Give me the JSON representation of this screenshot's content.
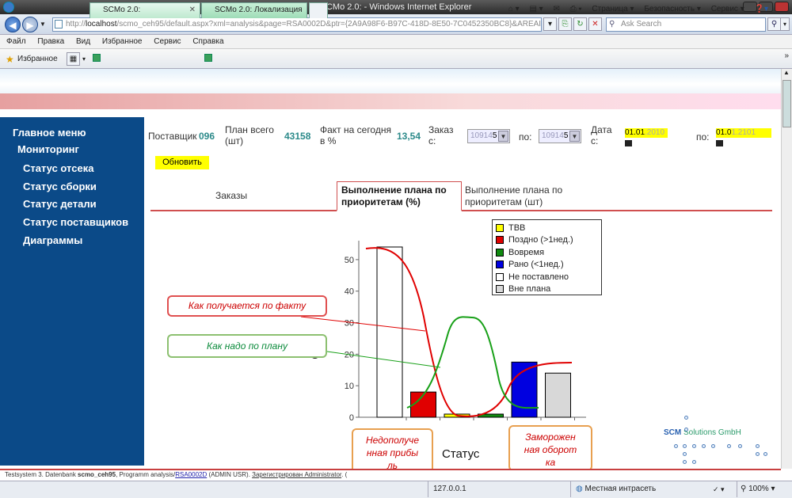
{
  "window": {
    "title": "SCMo 2.0: - Windows Internet Explorer"
  },
  "address": {
    "url_prefix": "http://",
    "url_host": "localhost",
    "url_rest": "/scmo_ceh95/default.aspx?xml=analysis&page=RSA0002D&ptr={2A9A98F6-B97C-418D-8E50-7C0452350BC8}&AREAID=2",
    "search_placeholder": "Ask Search"
  },
  "menubar": [
    "Файл",
    "Правка",
    "Вид",
    "Избранное",
    "Сервис",
    "Справка"
  ],
  "favbar": {
    "favorites_label": "Избранное",
    "tabs": [
      "SCMo 2.0:",
      "SCMo 2.0: Локализация"
    ],
    "tab_close": "✕",
    "commands": [
      "Страница ▾",
      "Безопасность ▾",
      "Сервис ▾"
    ]
  },
  "sidebar": {
    "items": [
      "Главное меню",
      "Мониторинг",
      "Статус отсека",
      "Статус сборки",
      "Статус детали",
      "Статус поставщиков",
      "Диаграммы"
    ]
  },
  "filters": {
    "supplier_label": "Поставщик",
    "supplier_value": "096",
    "plan_label_1": "План всего",
    "plan_label_2": "(шт)",
    "plan_value": "43158",
    "fact_label_1": "Факт на сегодня",
    "fact_label_2": "в %",
    "fact_value": "13,54",
    "order_label_1": "Заказ",
    "order_label_2": "с:",
    "order_from": "10914",
    "order_from_suffix": "5",
    "to_label": "по:",
    "order_to": "10914",
    "order_to_suffix": "5",
    "date_label_1": "Дата",
    "date_label_2": "с:",
    "date_from_a": "01.01",
    "date_from_b": ".2010",
    "date_to_label": "по:",
    "date_to_a": "01.0",
    "date_to_b": "1.2101",
    "update_button": "Обновить"
  },
  "tabs": [
    "Заказы",
    "Выполнение плана по приоритетам (%)",
    "Выполнение плана по приоритетам (шт)"
  ],
  "callouts": {
    "fact": "Как получается по факту",
    "plan": "Как надо по плану",
    "lost_profit": "Недополученная прибыль",
    "frozen": "Замороженная оборотка"
  },
  "brand": {
    "scm": "SCM",
    "rest": "Solutions GmbH"
  },
  "footer": {
    "text_1": "Testsystem 3. Datenbank ",
    "db": "scmo_ceh95",
    "text_2": ", Programm analysis/",
    "prog": "RSA0002D",
    "text_3": " (ADMIN USR). ",
    "user": "Зарегистрирован Administrator",
    "text_4": ". ("
  },
  "status": {
    "ip": "127.0.0.1",
    "zone": "Местная интрасеть",
    "zoom": "100%"
  },
  "chart_data": {
    "type": "bar",
    "categories": [
      "Не поставлено",
      "Поздно (>1нед.)",
      "ТВВ",
      "Вовремя",
      "Рано (<1нед.)",
      "Вне плана"
    ],
    "values": [
      54,
      8,
      1,
      1,
      17.5,
      14
    ],
    "colors": [
      "#ffffff",
      "#e00000",
      "#ffff00",
      "#108a10",
      "#0000e0",
      "#d8d8d8"
    ],
    "xlabel": "Статус",
    "ylabel": "С",
    "ylim": [
      0,
      55
    ],
    "yticks": [
      0,
      10,
      20,
      30,
      40,
      50
    ],
    "legend": [
      {
        "label": "ТВВ",
        "color": "#ffff00"
      },
      {
        "label": "Поздно (>1нед.)",
        "color": "#e00000"
      },
      {
        "label": "Вовремя",
        "color": "#108a10"
      },
      {
        "label": "Рано (<1нед.)",
        "color": "#0000e0"
      },
      {
        "label": "Не поставлено",
        "color": "#ffffff"
      },
      {
        "label": "Вне плана",
        "color": "#d8d8d8"
      }
    ],
    "legend_position": "top-right",
    "grid": false
  }
}
